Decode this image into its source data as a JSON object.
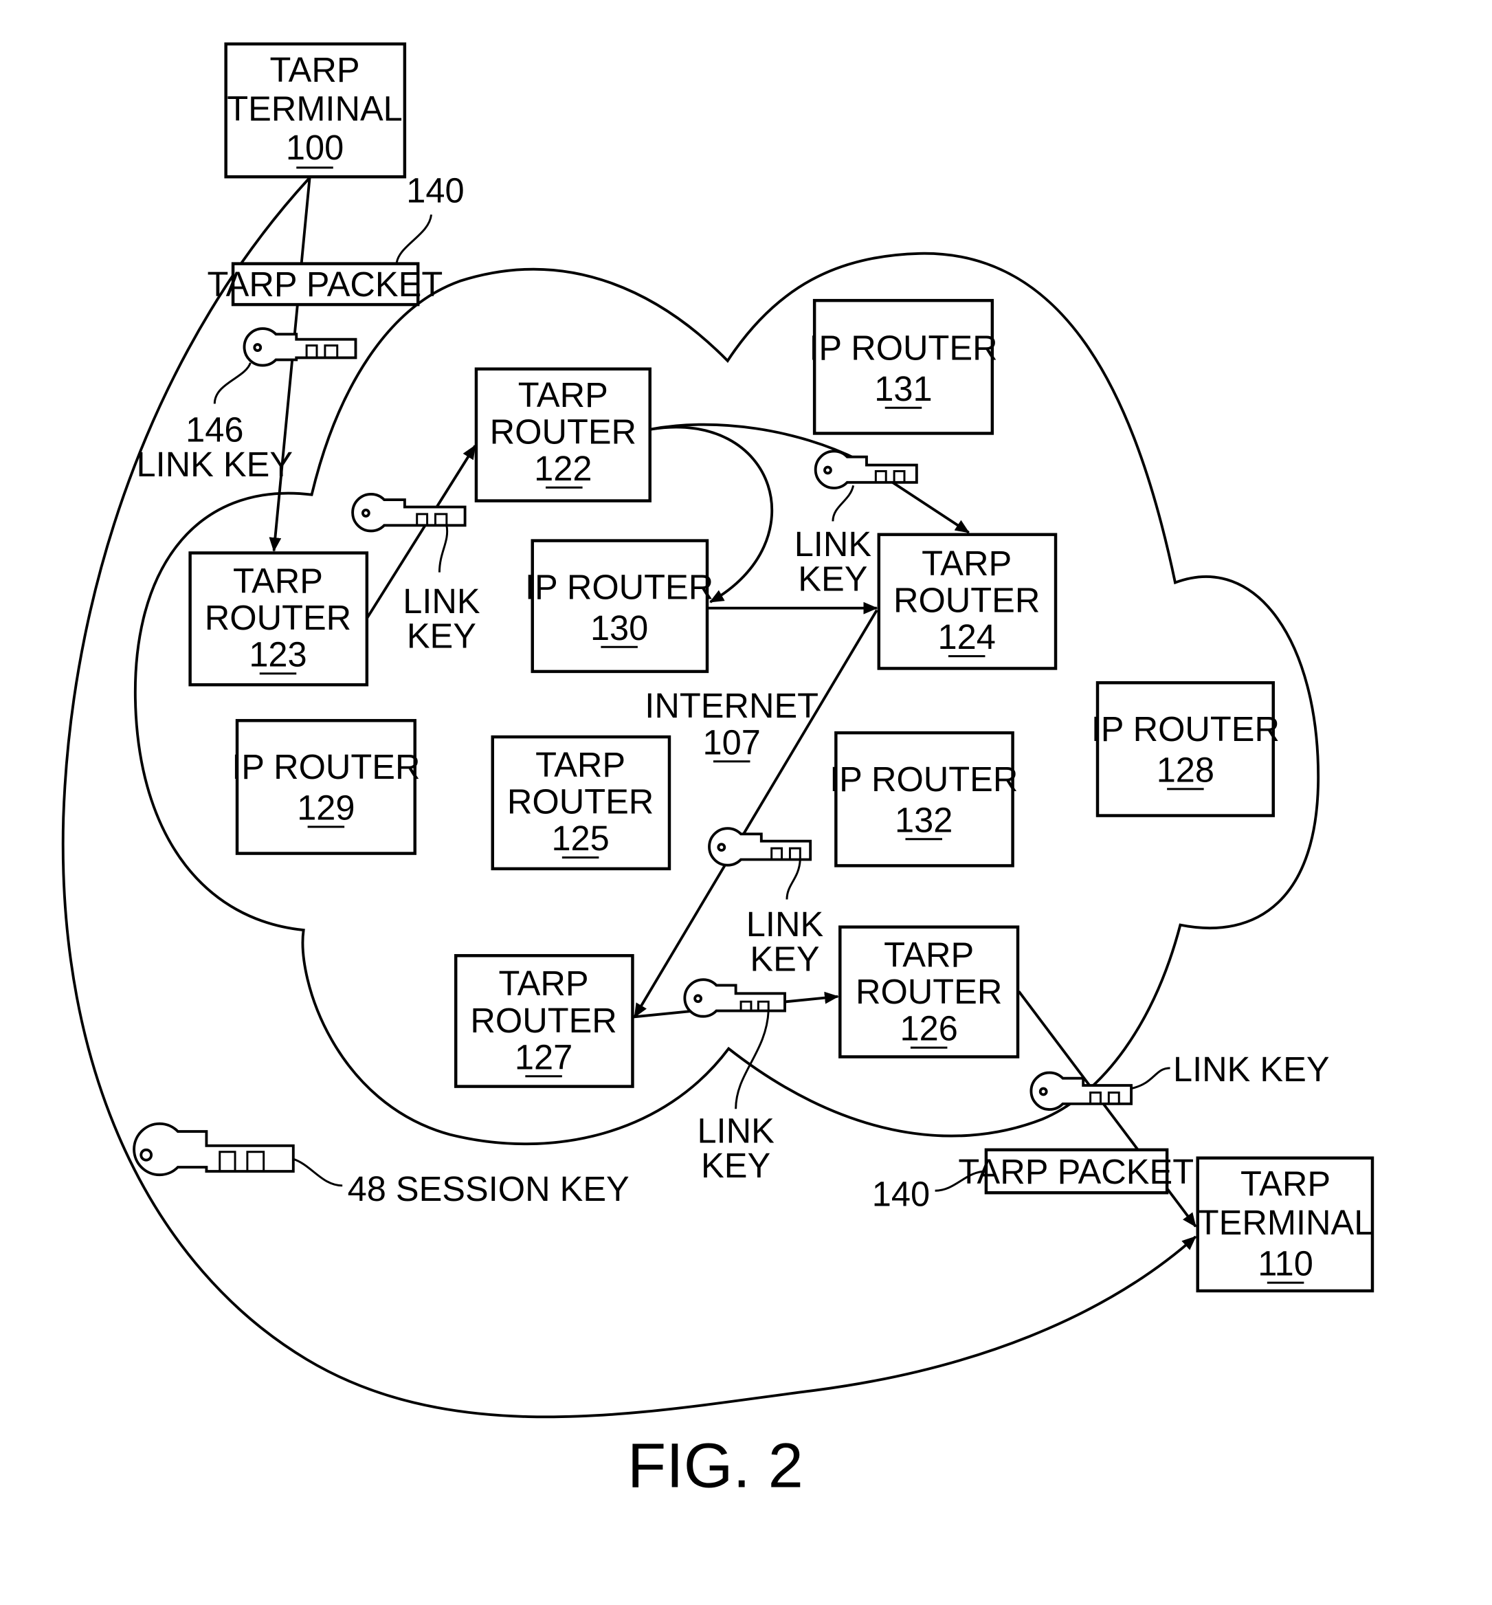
{
  "figure": {
    "caption": "FIG. 2",
    "network": {
      "name": "INTERNET",
      "ref": "107"
    },
    "nodes": {
      "t100": {
        "lines": [
          "TARP",
          "TERMINAL"
        ],
        "ref": "100"
      },
      "t110": {
        "lines": [
          "TARP",
          "TERMINAL"
        ],
        "ref": "110"
      },
      "r122": {
        "lines": [
          "TARP",
          "ROUTER"
        ],
        "ref": "122"
      },
      "r123": {
        "lines": [
          "TARP",
          "ROUTER"
        ],
        "ref": "123"
      },
      "r124": {
        "lines": [
          "TARP",
          "ROUTER"
        ],
        "ref": "124"
      },
      "r125": {
        "lines": [
          "TARP",
          "ROUTER"
        ],
        "ref": "125"
      },
      "r126": {
        "lines": [
          "TARP",
          "ROUTER"
        ],
        "ref": "126"
      },
      "r127": {
        "lines": [
          "TARP",
          "ROUTER"
        ],
        "ref": "127"
      },
      "ip128": {
        "lines": [
          "IP ROUTER"
        ],
        "ref": "128"
      },
      "ip129": {
        "lines": [
          "IP ROUTER"
        ],
        "ref": "129"
      },
      "ip130": {
        "lines": [
          "IP ROUTER"
        ],
        "ref": "130"
      },
      "ip131": {
        "lines": [
          "IP ROUTER"
        ],
        "ref": "131"
      },
      "ip132": {
        "lines": [
          "IP ROUTER"
        ],
        "ref": "132"
      }
    },
    "packets": {
      "top": {
        "label": "TARP PACKET",
        "ref": "140"
      },
      "bottom": {
        "label": "TARP PACKET",
        "ref": "140"
      }
    },
    "keys": {
      "k146": {
        "ref": "146",
        "label": "LINK KEY"
      },
      "k123_122": {
        "line1": "LINK",
        "line2": "KEY"
      },
      "k122_124": {
        "line1": "LINK",
        "line2": "KEY"
      },
      "k124_127": {
        "line1": "LINK",
        "line2": "KEY"
      },
      "k127_126": {
        "line1": "LINK",
        "line2": "KEY"
      },
      "k126_110": {
        "label": "LINK KEY"
      },
      "session": {
        "label": "48 SESSION KEY"
      }
    }
  }
}
